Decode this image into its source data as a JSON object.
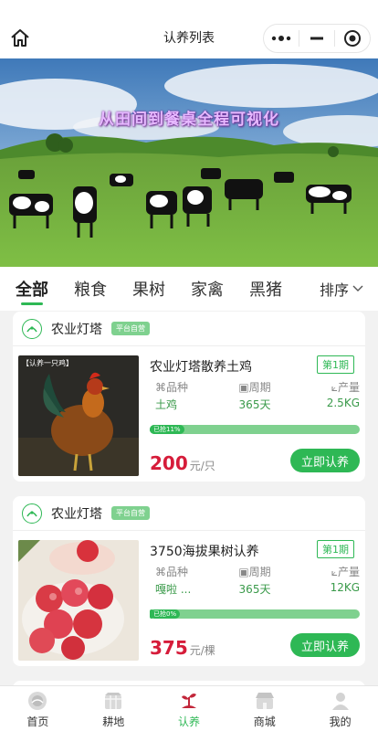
{
  "header": {
    "title": "认养列表"
  },
  "banner": {
    "slogan": "从田间到餐桌全程可视化"
  },
  "tabs": [
    {
      "label": "全部",
      "active": true
    },
    {
      "label": "粮食",
      "active": false
    },
    {
      "label": "果树",
      "active": false
    },
    {
      "label": "家禽",
      "active": false
    },
    {
      "label": "黑猪",
      "active": false
    }
  ],
  "sort": {
    "label": "排序"
  },
  "cards": [
    {
      "store": "农业灯塔",
      "tag": "平台自营",
      "thumb_caption": "【认养一只鸡】",
      "name": "农业灯塔散养土鸡",
      "period": "第1期",
      "attrs": [
        {
          "label": "品种",
          "value": "土鸡"
        },
        {
          "label": "周期",
          "value": "365天"
        },
        {
          "label": "产量",
          "value": "2.5KG"
        }
      ],
      "progress_label": "已抢11%",
      "progress_percent": 11,
      "price": "200",
      "unit": "元/只",
      "button": "立即认养"
    },
    {
      "store": "农业灯塔",
      "tag": "平台自营",
      "name": "3750海拔果树认养",
      "period": "第1期",
      "attrs": [
        {
          "label": "品种",
          "value": "嘎啦 ..."
        },
        {
          "label": "周期",
          "value": "365天"
        },
        {
          "label": "产量",
          "value": "12KG"
        }
      ],
      "progress_label": "已抢0%",
      "progress_percent": 0,
      "price": "375",
      "unit": "元/棵",
      "button": "立即认养"
    }
  ],
  "bottom_nav": [
    {
      "label": "首页",
      "icon": "home-icon",
      "active": false
    },
    {
      "label": "耕地",
      "icon": "field-icon",
      "active": false
    },
    {
      "label": "认养",
      "icon": "adopt-icon",
      "active": true
    },
    {
      "label": "商城",
      "icon": "shop-icon",
      "active": false
    },
    {
      "label": "我的",
      "icon": "user-icon",
      "active": false
    }
  ],
  "colors": {
    "accent": "#2eb855",
    "price": "#d61c3a",
    "tag": "#7fd18f"
  }
}
